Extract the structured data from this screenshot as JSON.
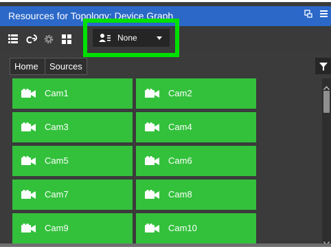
{
  "window": {
    "title": "Resources for Topology: Device Graph",
    "icons": [
      "restore-icon",
      "menu-icon"
    ]
  },
  "toolbar": {
    "icons": [
      "list-view-icon",
      "link-icon",
      "settings-icon",
      "grid-view-icon"
    ],
    "selector": {
      "icon": "user-filter-icon",
      "value": "None"
    }
  },
  "breadcrumb": {
    "items": [
      "Home",
      "Sources"
    ]
  },
  "filter": {
    "icon": "filter-icon"
  },
  "sources": [
    {
      "label": "Cam1",
      "icon": "camera-icon"
    },
    {
      "label": "Cam2",
      "icon": "camera-icon"
    },
    {
      "label": "Cam3",
      "icon": "camera-icon"
    },
    {
      "label": "Cam4",
      "icon": "camera-icon"
    },
    {
      "label": "Cam5",
      "icon": "camera-icon"
    },
    {
      "label": "Cam6",
      "icon": "camera-icon"
    },
    {
      "label": "Cam7",
      "icon": "camera-icon"
    },
    {
      "label": "Cam8",
      "icon": "camera-icon"
    },
    {
      "label": "Cam9",
      "icon": "camera-icon"
    },
    {
      "label": "Cam10",
      "icon": "camera-icon"
    }
  ],
  "colors": {
    "title_bar": "#2b68c8",
    "panel": "#3b3b3b",
    "tile": "#33c13c",
    "highlight": "#00e000"
  }
}
